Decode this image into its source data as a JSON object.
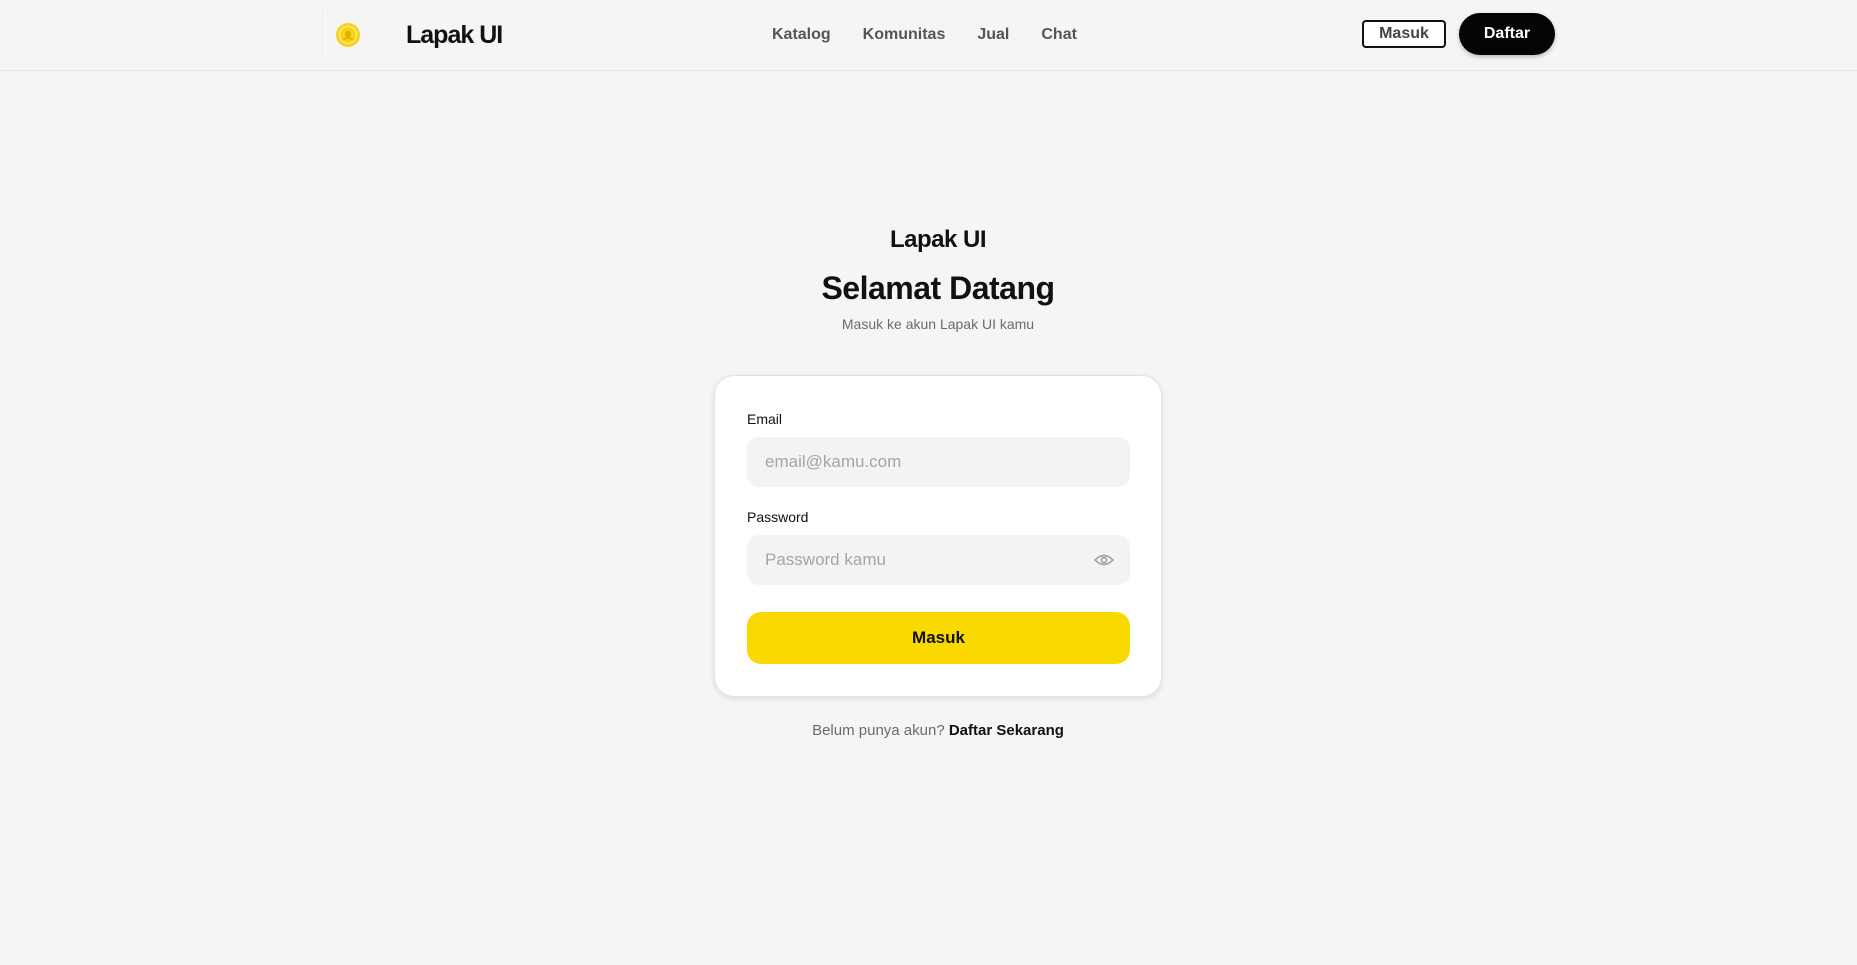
{
  "header": {
    "brand_name": "Lapak UI",
    "logo_icon": "makara-logo-icon",
    "nav": [
      "Katalog",
      "Komunitas",
      "Jual",
      "Chat"
    ],
    "login_label": "Masuk",
    "register_label": "Daftar"
  },
  "main": {
    "app_name": "Lapak UI",
    "title": "Selamat Datang",
    "subtitle": "Masuk ke akun Lapak UI kamu"
  },
  "form": {
    "email_label": "Email",
    "email_placeholder": "email@kamu.com",
    "email_value": "",
    "password_label": "Password",
    "password_placeholder": "Password kamu",
    "password_value": "",
    "password_toggle_icon": "eye-icon",
    "submit_label": "Masuk"
  },
  "footer": {
    "prompt": "Belum punya akun?",
    "link": "Daftar Sekarang"
  },
  "colors": {
    "accent": "#f9d900",
    "primary_dark": "#050505",
    "background": "#f5f5f5"
  }
}
